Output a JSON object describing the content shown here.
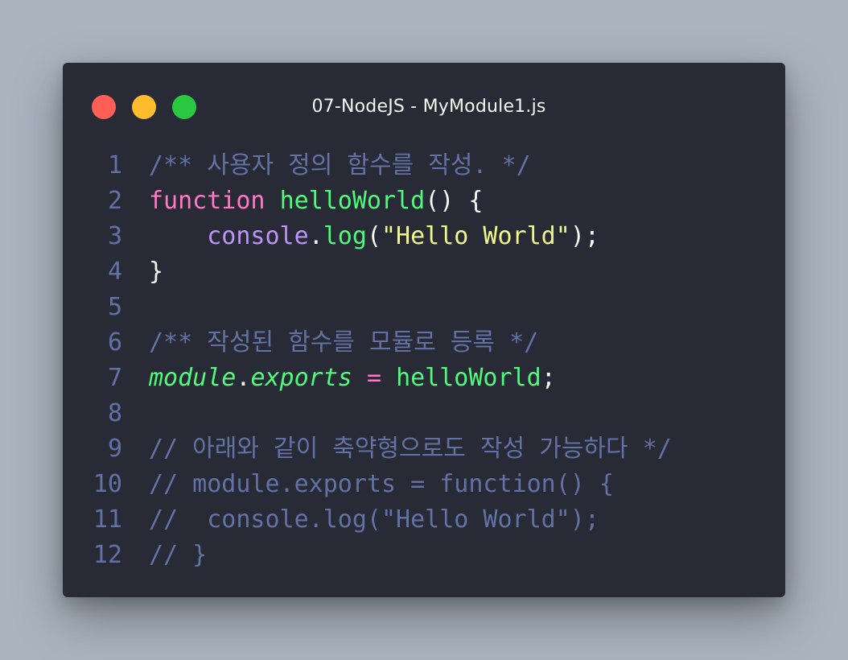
{
  "window": {
    "title": "07-NodeJS - MyModule1.js",
    "buttons": [
      {
        "name": "close",
        "color": "#ff5f57"
      },
      {
        "name": "minimize",
        "color": "#ffbd2e"
      },
      {
        "name": "maximize",
        "color": "#28c940"
      }
    ]
  },
  "code": {
    "lines": [
      {
        "number": "1",
        "tokens": [
          {
            "text": "/** 사용자 정의 함수를 작성. */",
            "type": "comment"
          }
        ]
      },
      {
        "number": "2",
        "tokens": [
          {
            "text": "function",
            "type": "keyword"
          },
          {
            "text": " ",
            "type": "plain"
          },
          {
            "text": "helloWorld",
            "type": "func"
          },
          {
            "text": "() {",
            "type": "plain"
          }
        ]
      },
      {
        "number": "3",
        "tokens": [
          {
            "text": "    ",
            "type": "plain"
          },
          {
            "text": "console",
            "type": "object"
          },
          {
            "text": ".",
            "type": "plain"
          },
          {
            "text": "log",
            "type": "func"
          },
          {
            "text": "(",
            "type": "plain"
          },
          {
            "text": "\"Hello World\"",
            "type": "string"
          },
          {
            "text": ");",
            "type": "plain"
          }
        ]
      },
      {
        "number": "4",
        "tokens": [
          {
            "text": "}",
            "type": "plain"
          }
        ]
      },
      {
        "number": "5",
        "tokens": []
      },
      {
        "number": "6",
        "tokens": [
          {
            "text": "/** 작성된 함수를 모듈로 등록 */",
            "type": "comment"
          }
        ]
      },
      {
        "number": "7",
        "tokens": [
          {
            "text": "module",
            "type": "func",
            "italic": true
          },
          {
            "text": ".",
            "type": "plain"
          },
          {
            "text": "exports",
            "type": "func",
            "italic": true
          },
          {
            "text": " ",
            "type": "plain"
          },
          {
            "text": "=",
            "type": "keyword"
          },
          {
            "text": " ",
            "type": "plain"
          },
          {
            "text": "helloWorld",
            "type": "func"
          },
          {
            "text": ";",
            "type": "plain"
          }
        ]
      },
      {
        "number": "8",
        "tokens": []
      },
      {
        "number": "9",
        "tokens": [
          {
            "text": "// 아래와 같이 축약형으로도 작성 가능하다 */",
            "type": "comment"
          }
        ]
      },
      {
        "number": "10",
        "tokens": [
          {
            "text": "// module.exports = function() {",
            "type": "comment"
          }
        ]
      },
      {
        "number": "11",
        "tokens": [
          {
            "text": "//  console.log(\"Hello World\");",
            "type": "comment"
          }
        ]
      },
      {
        "number": "12",
        "tokens": [
          {
            "text": "// }",
            "type": "comment"
          }
        ]
      }
    ]
  },
  "colors": {
    "background": "#a9b4bf",
    "window": "#282a36",
    "comment": "#6272a4",
    "keyword": "#ff79c6",
    "function": "#50fa7b",
    "object": "#bd93f9",
    "string": "#f1fa8c",
    "text": "#f8f8f2"
  }
}
